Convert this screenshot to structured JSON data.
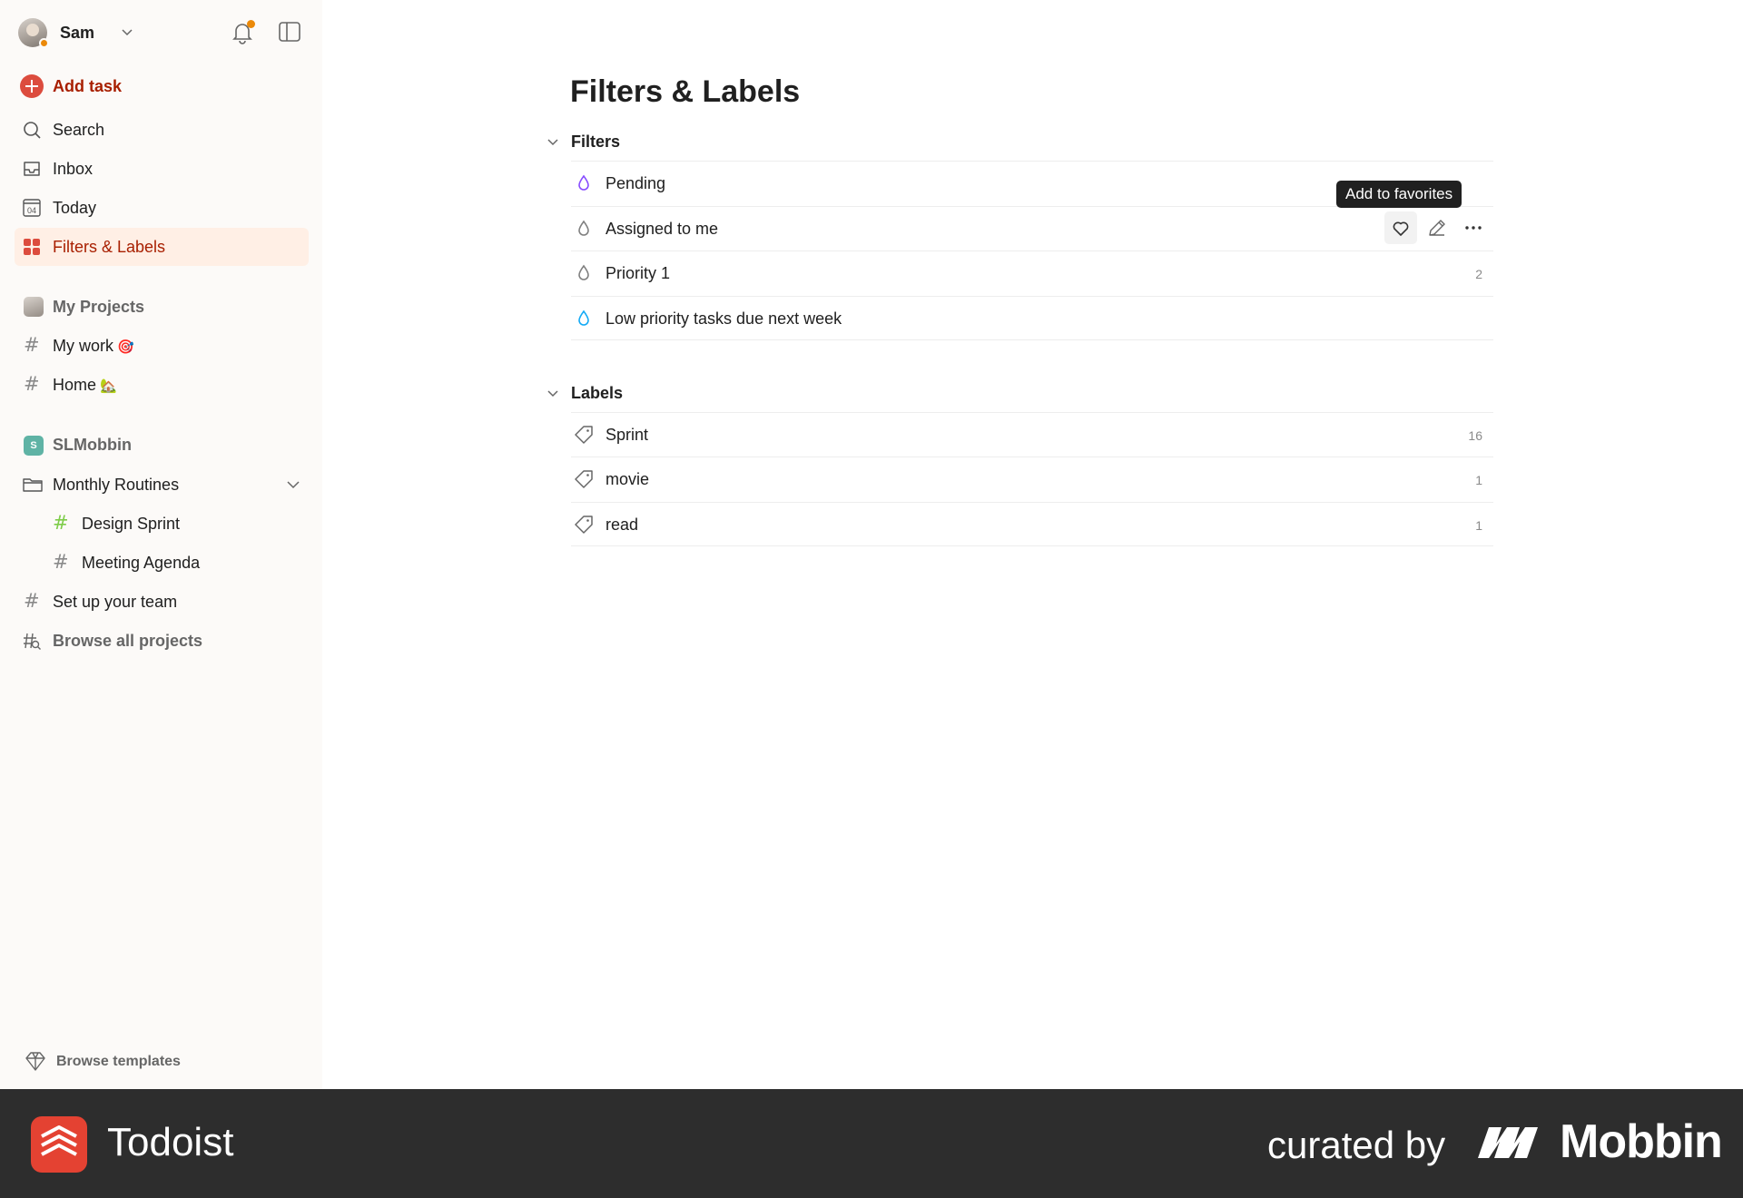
{
  "user": {
    "name": "Sam"
  },
  "sidebar": {
    "add_task": "Add task",
    "nav": [
      {
        "label": "Search"
      },
      {
        "label": "Inbox"
      },
      {
        "label": "Today",
        "day": "04"
      },
      {
        "label": "Filters & Labels"
      }
    ],
    "my_projects": {
      "title": "My Projects",
      "items": [
        {
          "label": "My work",
          "emoji": "🎯"
        },
        {
          "label": "Home",
          "emoji": "🏡"
        }
      ]
    },
    "team": {
      "badge": "S",
      "title": "SLMobbin",
      "folder": "Monthly Routines",
      "folder_items": [
        {
          "label": "Design Sprint"
        },
        {
          "label": "Meeting Agenda"
        }
      ],
      "items": [
        {
          "label": "Set up your team"
        },
        {
          "label": "Browse all projects"
        }
      ]
    },
    "browse_templates": "Browse templates"
  },
  "main": {
    "title": "Filters & Labels",
    "filters": {
      "title": "Filters",
      "items": [
        {
          "label": "Pending",
          "color": "#884dff",
          "count": ""
        },
        {
          "label": "Assigned to me",
          "color": "#808080",
          "count": ""
        },
        {
          "label": "Priority 1",
          "color": "#808080",
          "count": "2"
        },
        {
          "label": "Low priority tasks due next week",
          "color": "#14aaf5",
          "count": ""
        }
      ]
    },
    "labels": {
      "title": "Labels",
      "items": [
        {
          "label": "Sprint",
          "count": "16"
        },
        {
          "label": "movie",
          "count": "1"
        },
        {
          "label": "read",
          "count": "1"
        }
      ]
    },
    "tooltip": "Add to favorites"
  },
  "footer": {
    "app_name": "Todoist",
    "curated_by": "curated by",
    "brand": "Mobbin"
  },
  "colors": {
    "accent": "#dc4c3e",
    "active_bg": "#ffefe5",
    "active_text": "#a81f00",
    "notification": "#eb8909"
  }
}
